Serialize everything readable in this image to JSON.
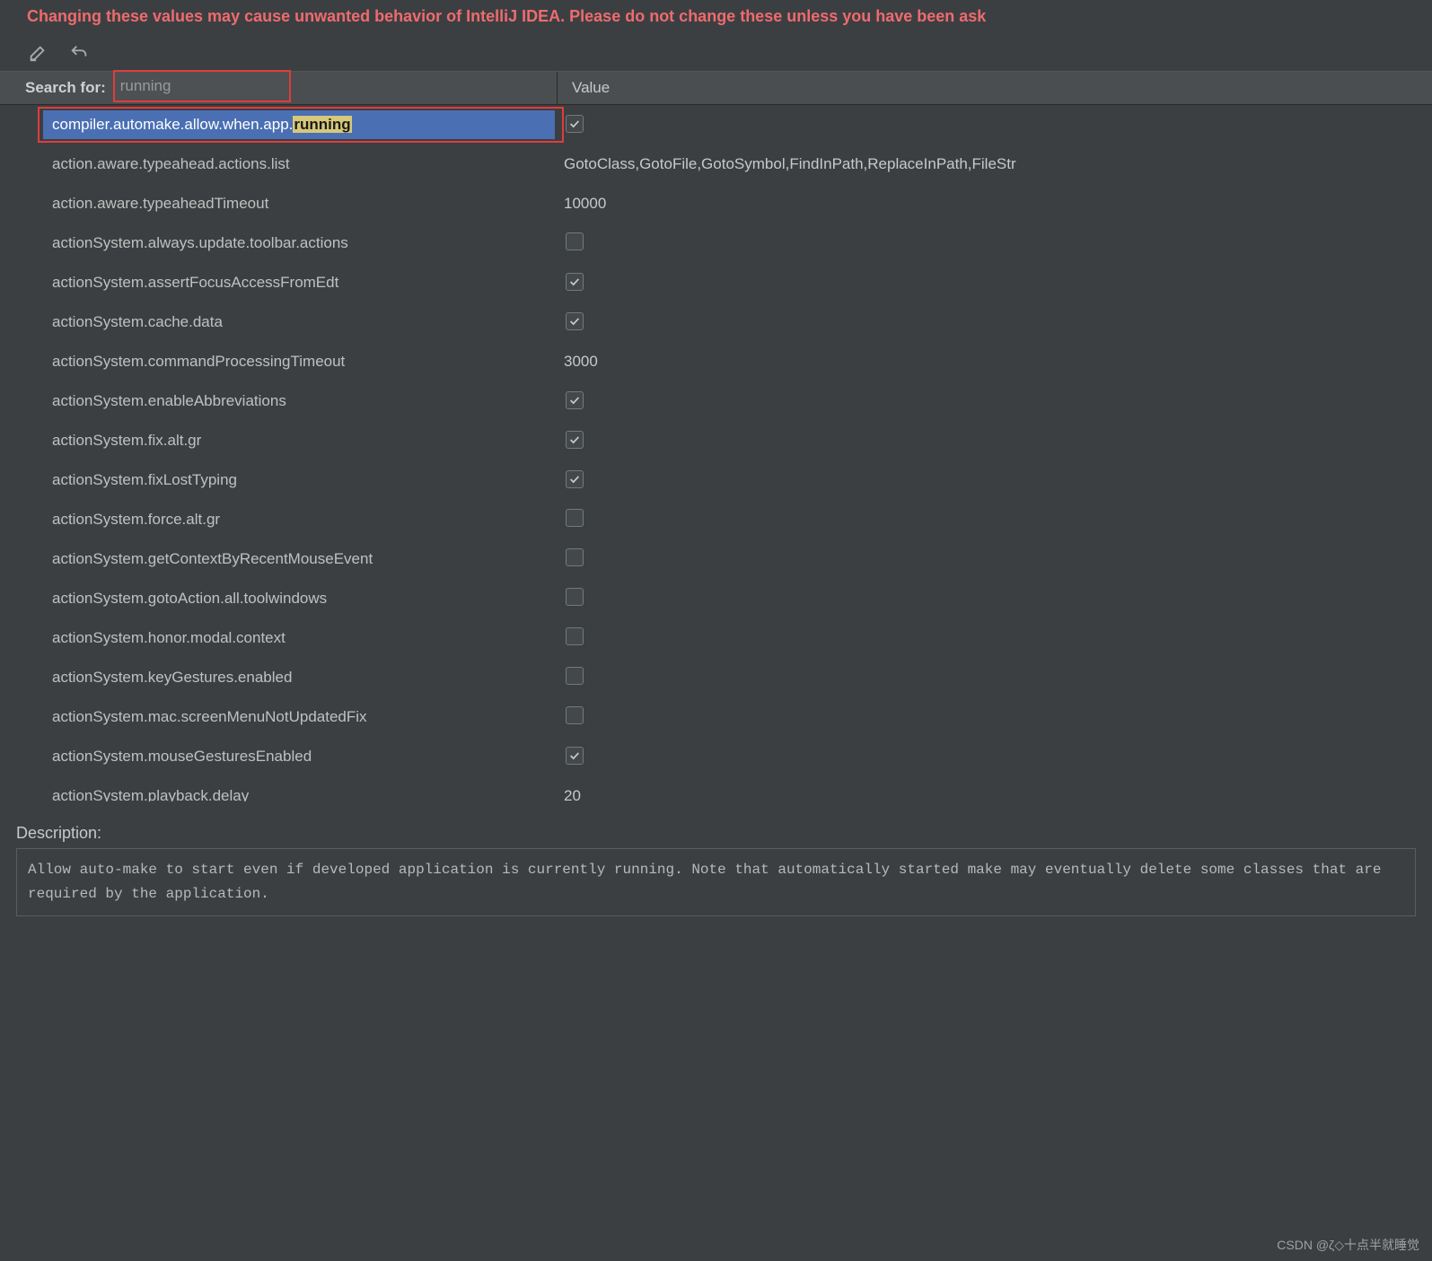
{
  "warning": {
    "text": "Changing these values may cause unwanted behavior of IntelliJ IDEA. Please do not change these unless you have been ask"
  },
  "search": {
    "label": "Search for:",
    "value": "running"
  },
  "header": {
    "value_label": "Value"
  },
  "rows": [
    {
      "name": "compiler.automake.allow.when.app.",
      "highlight": "running",
      "type": "check",
      "checked": true,
      "selected": true
    },
    {
      "name": "action.aware.typeahead.actions.list",
      "type": "text",
      "value": "GotoClass,GotoFile,GotoSymbol,FindInPath,ReplaceInPath,FileStr"
    },
    {
      "name": "action.aware.typeaheadTimeout",
      "type": "text",
      "value": "10000"
    },
    {
      "name": "actionSystem.always.update.toolbar.actions",
      "type": "check",
      "checked": false
    },
    {
      "name": "actionSystem.assertFocusAccessFromEdt",
      "type": "check",
      "checked": true
    },
    {
      "name": "actionSystem.cache.data",
      "type": "check",
      "checked": true
    },
    {
      "name": "actionSystem.commandProcessingTimeout",
      "type": "text",
      "value": "3000"
    },
    {
      "name": "actionSystem.enableAbbreviations",
      "type": "check",
      "checked": true
    },
    {
      "name": "actionSystem.fix.alt.gr",
      "type": "check",
      "checked": true
    },
    {
      "name": "actionSystem.fixLostTyping",
      "type": "check",
      "checked": true
    },
    {
      "name": "actionSystem.force.alt.gr",
      "type": "check",
      "checked": false
    },
    {
      "name": "actionSystem.getContextByRecentMouseEvent",
      "type": "check",
      "checked": false
    },
    {
      "name": "actionSystem.gotoAction.all.toolwindows",
      "type": "check",
      "checked": false
    },
    {
      "name": "actionSystem.honor.modal.context",
      "type": "check",
      "checked": false
    },
    {
      "name": "actionSystem.keyGestures.enabled",
      "type": "check",
      "checked": false
    },
    {
      "name": "actionSystem.mac.screenMenuNotUpdatedFix",
      "type": "check",
      "checked": false
    },
    {
      "name": "actionSystem.mouseGesturesEnabled",
      "type": "check",
      "checked": true
    },
    {
      "name": "actionSystem.playback.delay",
      "type": "text",
      "value": "20"
    }
  ],
  "description": {
    "label": "Description:",
    "text": "Allow auto-make to start even if developed application is currently running. Note that automatically started make may eventually delete some classes that are required by the application."
  },
  "watermark": "CSDN @ζ◇十点半就睡觉"
}
